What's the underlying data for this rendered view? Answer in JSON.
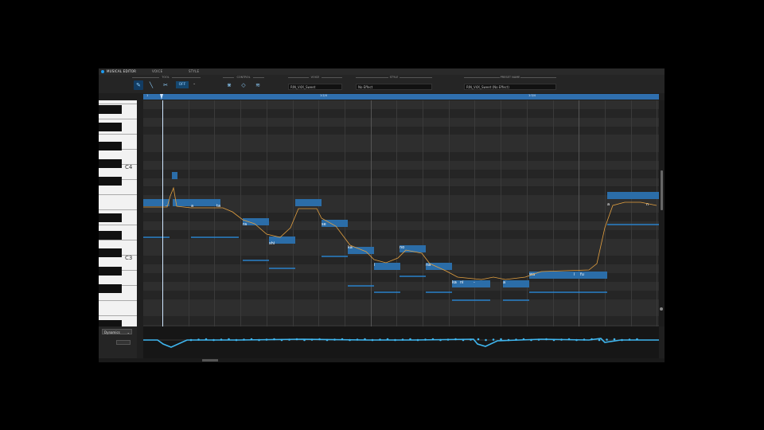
{
  "tabs": [
    {
      "label": "MUSICAL EDITOR",
      "active": true
    },
    {
      "label": "VOICE",
      "active": false
    },
    {
      "label": "STYLE",
      "active": false
    }
  ],
  "toolbar": {
    "tool_label": "TOOL",
    "off_label": "OFF",
    "control_label": "CONTROL",
    "voice_label": "VOICE",
    "voice_value": "RIN_V4X_Sweet",
    "style_label": "STYLE",
    "style_value": "No Effect",
    "preset_label": "PRESET NAME",
    "preset_value": "RIN_V4X_Sweet (No Effect)"
  },
  "ruler": {
    "bars": [
      "1",
      "1:2/4",
      "1:3/4"
    ]
  },
  "keyboard": {
    "labels": [
      "C4",
      "C3"
    ]
  },
  "lyrics": [
    "-",
    "a",
    "ta",
    "ra",
    "shi",
    "se",
    "ka",
    "i",
    "no",
    "na",
    "ka",
    "ni",
    "-",
    "a",
    "wa",
    "i",
    "fu",
    "a",
    "n"
  ],
  "lane": {
    "parameter": "Dynamics"
  },
  "colors": {
    "accent": "#1e9bf0",
    "note": "#2b6da8",
    "pitch_curve": "#e3a040",
    "dynamics": "#3fb6ef"
  },
  "icons": [
    "pencil-icon",
    "line-icon",
    "scissors-icon",
    "vibrato-icon",
    "smooth-icon",
    "wave-icon"
  ]
}
